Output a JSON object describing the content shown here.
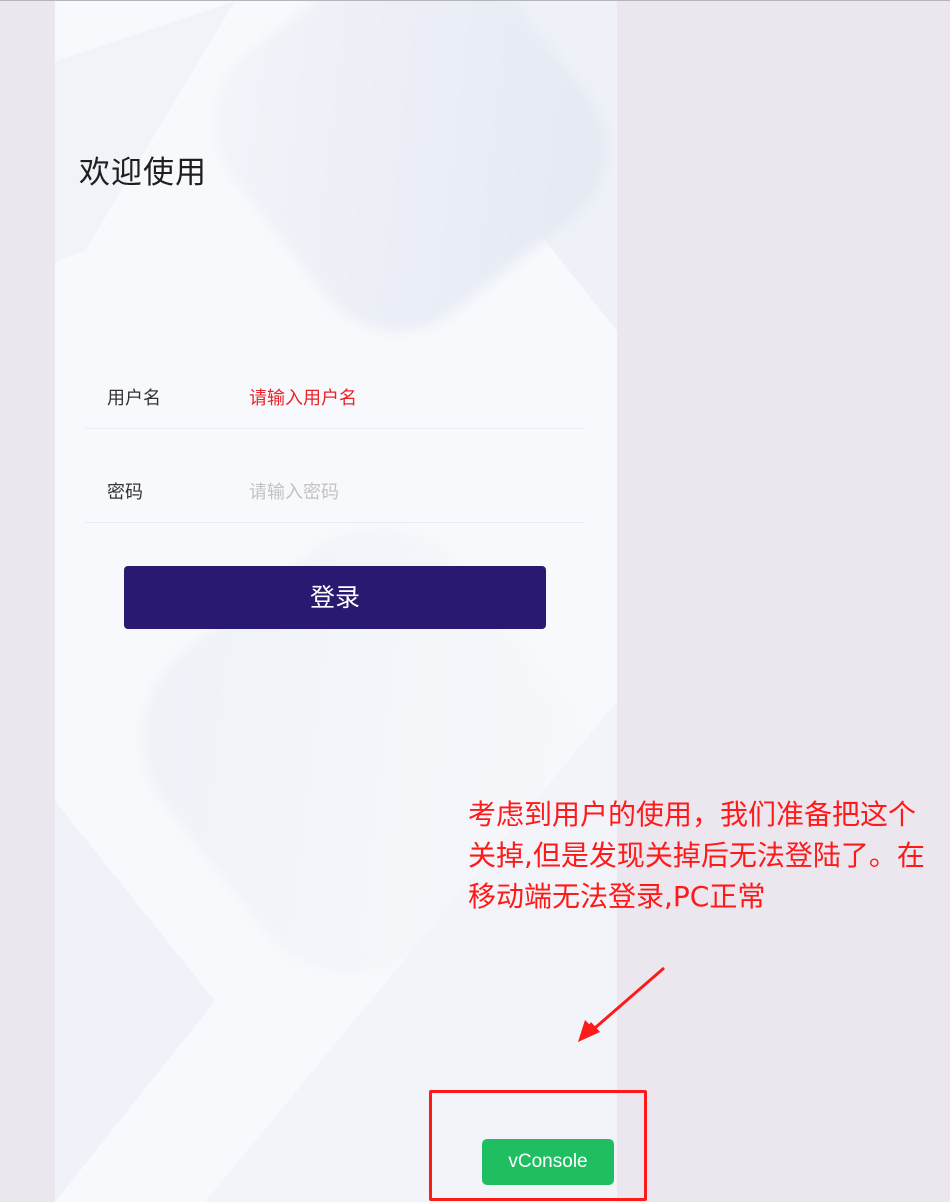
{
  "login": {
    "title": "欢迎使用",
    "username_label": "用户名",
    "username_placeholder": "请输入用户名",
    "password_label": "密码",
    "password_placeholder": "请输入密码",
    "login_button": "登录"
  },
  "annotation": {
    "text": "考虑到用户的使用，我们准备把这个关掉,但是发现关掉后无法登陆了。在移动端无法登录,PC正常",
    "color": "#ff1a1a"
  },
  "vconsole": {
    "label": "vConsole",
    "color": "#1ebe61"
  },
  "colors": {
    "primary_button": "#2a1970",
    "error_placeholder": "#e8232a",
    "page_background": "#ece6ef"
  }
}
